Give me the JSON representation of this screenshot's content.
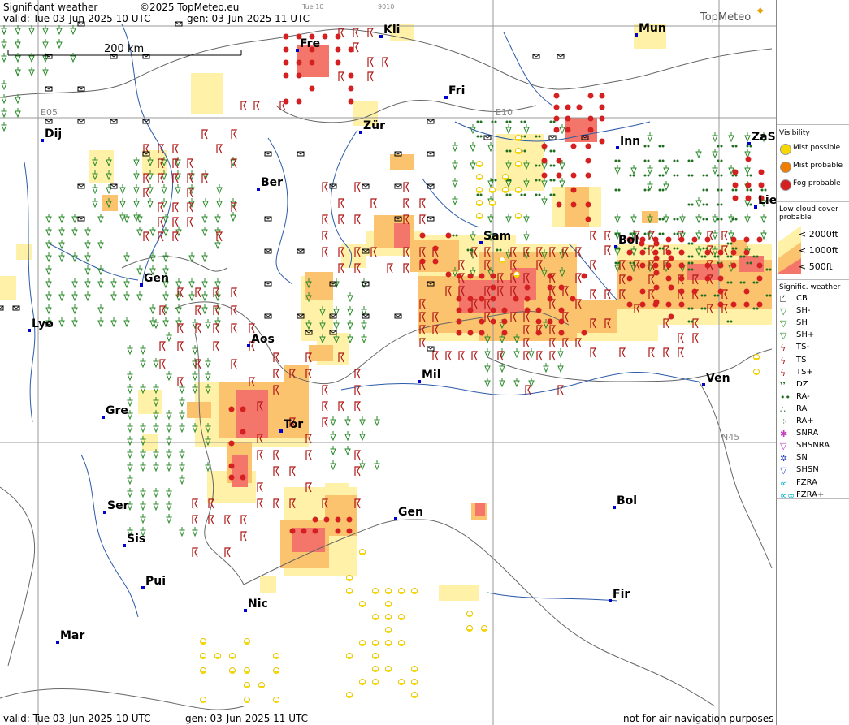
{
  "header": {
    "title": "Significant weather",
    "copyright": "©2025 TopMeteo.eu",
    "valid_top": "valid:  Tue  03-Jun-2025  10 UTC",
    "gen_top": "gen: 03-Jun-2025 11 UTC",
    "faint_day": "Tue 10",
    "faint_code": "9010",
    "brand": "TopMeteo"
  },
  "footer": {
    "valid": "valid:  Tue  03-Jun-2025  10 UTC",
    "gen": "gen: 03-Jun-2025 11 UTC",
    "disclaimer": "not for air navigation purposes"
  },
  "scale": {
    "label": "200 km"
  },
  "grid_labels": {
    "e05": "E05",
    "e10": "E10",
    "n45": "N45"
  },
  "cities": [
    {
      "name": "Fre"
    },
    {
      "name": "Kli"
    },
    {
      "name": "Mun"
    },
    {
      "name": "Fri"
    },
    {
      "name": "Dij"
    },
    {
      "name": "Zür"
    },
    {
      "name": "Inn"
    },
    {
      "name": "ZaS"
    },
    {
      "name": "Ber"
    },
    {
      "name": "Lie"
    },
    {
      "name": "Sam"
    },
    {
      "name": "Bol"
    },
    {
      "name": "Gen"
    },
    {
      "name": "Lyo"
    },
    {
      "name": "Aos"
    },
    {
      "name": "Mil"
    },
    {
      "name": "Ven"
    },
    {
      "name": "Gre"
    },
    {
      "name": "Tor"
    },
    {
      "name": "Ser"
    },
    {
      "name": "Gen"
    },
    {
      "name": "Bol"
    },
    {
      "name": "Sis"
    },
    {
      "name": "Pui"
    },
    {
      "name": "Nic"
    },
    {
      "name": "Fir"
    },
    {
      "name": "Mar"
    }
  ],
  "legend": {
    "visibility_title": "Visibility",
    "visibility": [
      {
        "label": "Mist possible",
        "color": "#f5d800"
      },
      {
        "label": "Mist probable",
        "color": "#f07c00"
      },
      {
        "label": "Fog probable",
        "color": "#d42020"
      }
    ],
    "lowcloud_title": "Low cloud cover probable",
    "lowcloud": [
      {
        "label": "< 2000ft",
        "color": "#fff2a8"
      },
      {
        "label": "< 1000ft",
        "color": "#fbc36d"
      },
      {
        "label": "<  500ft",
        "color": "#f4766a"
      }
    ],
    "sigwx_title": "Signific. weather",
    "sigwx": [
      {
        "label": "CB",
        "icon": "cb-icon"
      },
      {
        "label": "SH-",
        "icon": "shower-light-icon"
      },
      {
        "label": "SH",
        "icon": "shower-icon"
      },
      {
        "label": "SH+",
        "icon": "shower-heavy-icon"
      },
      {
        "label": "TS-",
        "icon": "thunderstorm-light-icon"
      },
      {
        "label": "TS",
        "icon": "thunderstorm-icon"
      },
      {
        "label": "TS+",
        "icon": "thunderstorm-heavy-icon"
      },
      {
        "label": "DZ",
        "icon": "drizzle-icon"
      },
      {
        "label": "RA-",
        "icon": "rain-light-icon"
      },
      {
        "label": "RA",
        "icon": "rain-icon"
      },
      {
        "label": "RA+",
        "icon": "rain-heavy-icon"
      },
      {
        "label": "SNRA",
        "icon": "snow-rain-icon"
      },
      {
        "label": "SHSNRA",
        "icon": "snow-rain-shower-icon"
      },
      {
        "label": "SN",
        "icon": "snow-icon"
      },
      {
        "label": "SHSN",
        "icon": "snow-shower-icon"
      },
      {
        "label": "FZRA",
        "icon": "freezing-rain-icon"
      },
      {
        "label": "FZRA+",
        "icon": "freezing-rain-heavy-icon"
      }
    ]
  }
}
